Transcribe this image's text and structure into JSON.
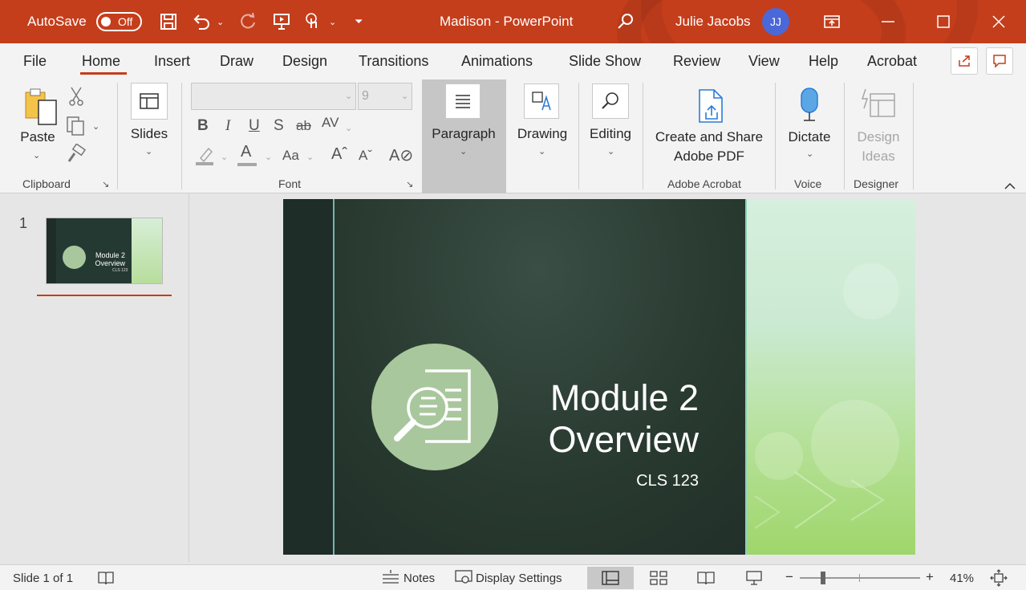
{
  "titlebar": {
    "autosave_label": "AutoSave",
    "autosave_state": "Off",
    "document_title": "Madison  -  PowerPoint",
    "user_name": "Julie Jacobs",
    "user_initials": "JJ",
    "icons": [
      "save-icon",
      "undo-icon",
      "redo-icon",
      "present-icon",
      "touch-mode-icon",
      "customize-qat-icon",
      "search-icon",
      "ribbon-display-icon",
      "minimize-icon",
      "maximize-icon",
      "close-icon"
    ]
  },
  "ribbon": {
    "tabs": [
      "File",
      "Home",
      "Insert",
      "Draw",
      "Design",
      "Transitions",
      "Animations",
      "Slide Show",
      "Review",
      "View",
      "Help",
      "Acrobat"
    ],
    "active_tab": "Home",
    "clipboard": {
      "paste": "Paste",
      "group": "Clipboard"
    },
    "slides": {
      "label": "Slides"
    },
    "font": {
      "font_name": "",
      "font_size": "9",
      "group": "Font"
    },
    "paragraph": {
      "label": "Paragraph"
    },
    "drawing": {
      "label": "Drawing"
    },
    "editing": {
      "label": "Editing"
    },
    "acrobat": {
      "label_line1": "Create and Share",
      "label_line2": "Adobe PDF",
      "group": "Adobe Acrobat"
    },
    "voice": {
      "label": "Dictate",
      "group": "Voice"
    },
    "designer": {
      "label_line1": "Design",
      "label_line2": "Ideas",
      "group": "Designer"
    }
  },
  "slides_pane": {
    "slide_number": "1",
    "thumb_title": "Module 2 Overview",
    "thumb_sub": "CLS 123"
  },
  "slide": {
    "title_line1": "Module 2",
    "title_line2": "Overview",
    "subtitle": "CLS 123"
  },
  "statusbar": {
    "slide_info": "Slide 1 of 1",
    "notes": "Notes",
    "display_settings": "Display Settings",
    "zoom": "41%"
  },
  "colors": {
    "accent": "#c43e1c",
    "slide_dark": "#263832",
    "slide_circle": "#a9c79d",
    "slide_green": "#b4e096"
  }
}
